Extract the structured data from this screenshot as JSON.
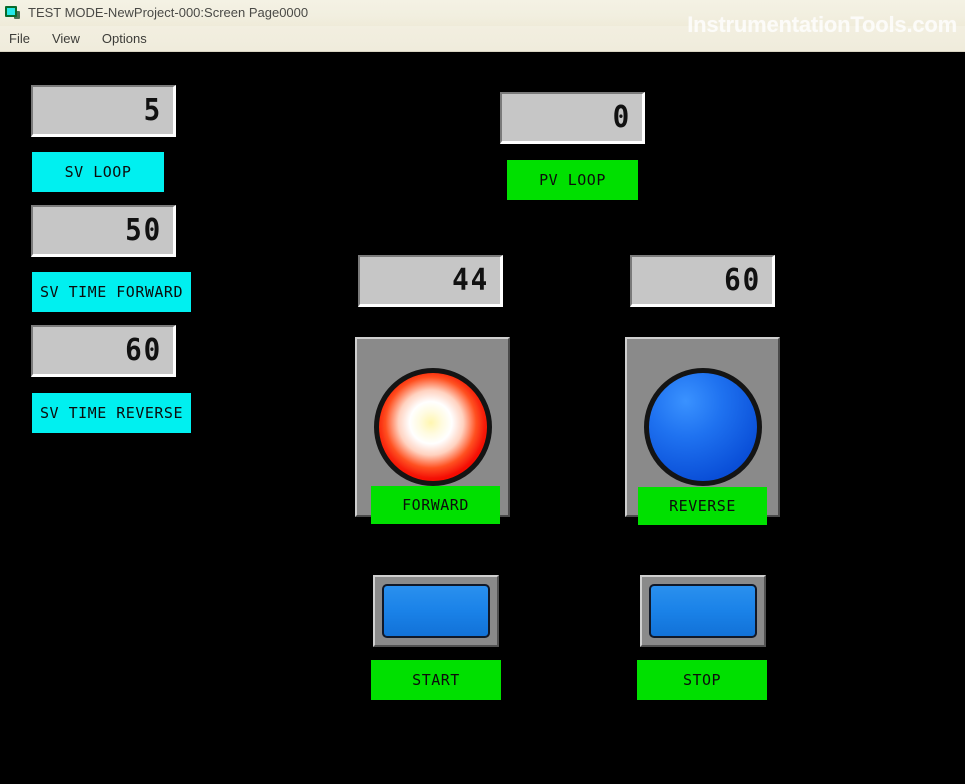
{
  "window": {
    "title": "TEST MODE-NewProject-000:Screen Page0000",
    "icon": "screen-page-icon"
  },
  "menu": {
    "items": [
      {
        "label": "File"
      },
      {
        "label": "View"
      },
      {
        "label": "Options"
      }
    ]
  },
  "watermark": {
    "text": "InstrumentationTools.com"
  },
  "colors": {
    "canvas_background": "#000000",
    "display_face": "#c6c6c6",
    "label_cyan": "#00F0F0",
    "label_green": "#00E000",
    "lamp_red_on": "#FF0000",
    "lamp_blue_off": "#1272D8",
    "button_blue": "#1A82E8",
    "panel_gray": "#8A8A8A",
    "titlebar": "#F2EFE0"
  },
  "left_column": {
    "sv_loop": {
      "value": "5",
      "label": "SV LOOP"
    },
    "sv_time_forward": {
      "value": "50",
      "label": "SV TIME FORWARD"
    },
    "sv_time_reverse": {
      "value": "60",
      "label": "SV TIME REVERSE"
    }
  },
  "process_value": {
    "pv_loop": {
      "value": "0",
      "label": "PV LOOP"
    }
  },
  "forward_group": {
    "display_value": "44",
    "lamp_state": "on",
    "lamp_color": "red",
    "label": "FORWARD",
    "button_label": "START",
    "button_color": "blue"
  },
  "reverse_group": {
    "display_value": "60",
    "lamp_state": "off",
    "lamp_color": "blue",
    "label": "REVERSE",
    "button_label": "STOP",
    "button_color": "blue"
  }
}
